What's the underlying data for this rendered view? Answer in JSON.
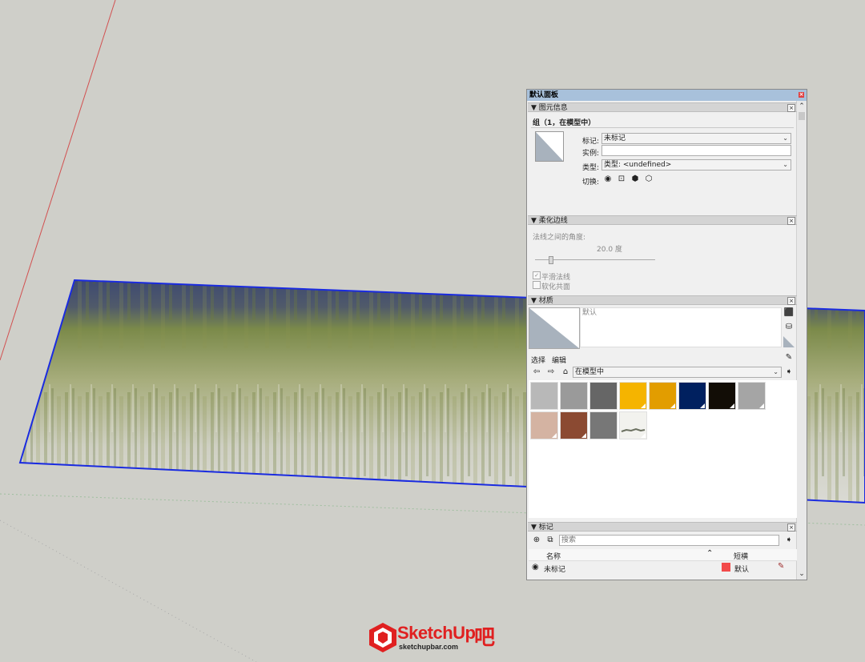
{
  "tray": {
    "title": "默认面板",
    "entity_info": {
      "header": "▼ 图元信息",
      "summary": "组（1，在模型中）",
      "tag_label": "标记:",
      "tag_value": "未标记",
      "instance_label": "实例:",
      "instance_value": "",
      "type_label": "类型:",
      "type_value": "类型: <undefined>",
      "toggles_label": "切换:"
    },
    "soften_edges": {
      "header": "▼ 柔化边线",
      "angle_label": "法线之间的角度:",
      "angle_value": "20.0  度",
      "smooth_normals": "平滑法线",
      "soften_coplanar": "软化共面"
    },
    "materials": {
      "header": "▼ 材质",
      "material_name": "默认",
      "tab_select": "选择",
      "tab_edit": "编辑",
      "library_value": "在模型中",
      "swatches": [
        {
          "color": "#b8b8b8",
          "corner": false
        },
        {
          "color": "#9a9a9a",
          "corner": false
        },
        {
          "color": "#666666",
          "corner": false
        },
        {
          "color": "#f5b400",
          "corner": true
        },
        {
          "color": "#e29d00",
          "corner": true
        },
        {
          "color": "#00205f",
          "corner": true
        },
        {
          "color": "#120d06",
          "corner": true
        },
        {
          "color": "#a5a5a5",
          "corner": true
        },
        {
          "color": "#d4b3a2",
          "corner": true
        },
        {
          "color": "#8b4a32",
          "corner": true
        },
        {
          "color": "#777777",
          "corner": false
        },
        {
          "color": "#f2f2ee",
          "corner": true
        }
      ]
    },
    "tags": {
      "header": "▼ 标记",
      "search_placeholder": "搜索",
      "col_name": "名称",
      "col_dash": "短横",
      "rows": [
        {
          "name": "未标记",
          "color": "#f24a4a",
          "dash": "默认"
        }
      ]
    }
  },
  "logo": {
    "brand": "SketchUp",
    "suffix": "吧",
    "site": "sketchupbar.com"
  }
}
